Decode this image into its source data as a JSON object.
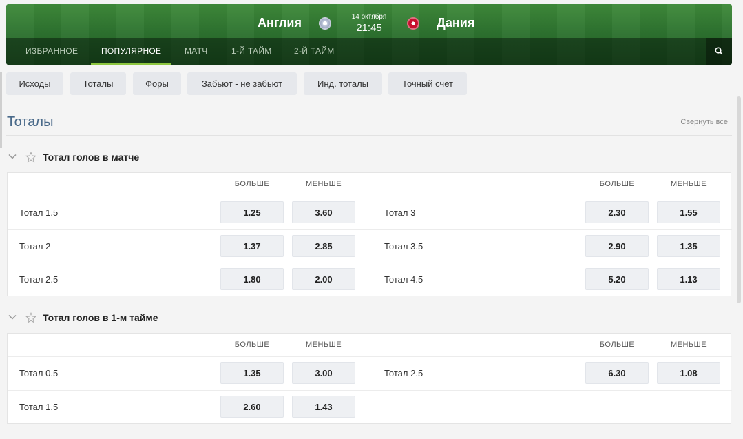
{
  "header": {
    "home_team": "Англия",
    "away_team": "Дания",
    "date": "14 октября",
    "time": "21:45",
    "home_flag_icon": "england-flag-icon",
    "away_flag_icon": "denmark-flag-icon"
  },
  "nav": {
    "tabs": [
      {
        "label": "ИЗБРАННОЕ",
        "active": false
      },
      {
        "label": "ПОПУЛЯРНОЕ",
        "active": true
      },
      {
        "label": "МАТЧ",
        "active": false
      },
      {
        "label": "1-Й ТАЙМ",
        "active": false
      },
      {
        "label": "2-Й ТАЙМ",
        "active": false
      }
    ],
    "search_icon": "search-icon"
  },
  "filters": [
    {
      "label": "Исходы"
    },
    {
      "label": "Тоталы"
    },
    {
      "label": "Форы"
    },
    {
      "label": "Забьют - не забьют"
    },
    {
      "label": "Инд. тоталы"
    },
    {
      "label": "Точный счет"
    }
  ],
  "section": {
    "title": "Тоталы",
    "collapse_all": "Свернуть все"
  },
  "markets": [
    {
      "title": "Тотал голов в матче",
      "col_over": "БОЛЬШЕ",
      "col_under": "МЕНЬШЕ",
      "rows": [
        {
          "left": {
            "label": "Тотал 1.5",
            "over": "1.25",
            "under": "3.60"
          },
          "right": {
            "label": "Тотал 3",
            "over": "2.30",
            "under": "1.55"
          }
        },
        {
          "left": {
            "label": "Тотал 2",
            "over": "1.37",
            "under": "2.85"
          },
          "right": {
            "label": "Тотал 3.5",
            "over": "2.90",
            "under": "1.35"
          }
        },
        {
          "left": {
            "label": "Тотал 2.5",
            "over": "1.80",
            "under": "2.00"
          },
          "right": {
            "label": "Тотал 4.5",
            "over": "5.20",
            "under": "1.13"
          }
        }
      ]
    },
    {
      "title": "Тотал голов в 1-м тайме",
      "col_over": "БОЛЬШЕ",
      "col_under": "МЕНЬШЕ",
      "rows": [
        {
          "left": {
            "label": "Тотал 0.5",
            "over": "1.35",
            "under": "3.00"
          },
          "right": {
            "label": "Тотал 2.5",
            "over": "6.30",
            "under": "1.08"
          }
        },
        {
          "left": {
            "label": "Тотал 1.5",
            "over": "2.60",
            "under": "1.43"
          },
          "right": null
        }
      ]
    }
  ],
  "colors": {
    "accent_green": "#8dc63f",
    "section_title": "#4a6a8a",
    "odd_bg": "#eef0f3"
  }
}
